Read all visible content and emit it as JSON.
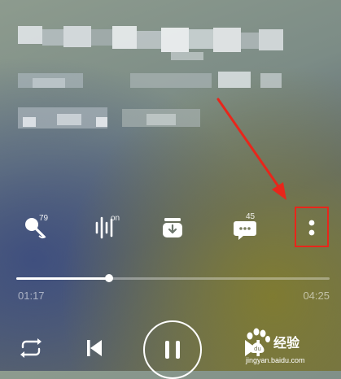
{
  "action_bar": {
    "karaoke_count": "79",
    "sound_effect_state": "on",
    "comments_count": "45"
  },
  "player": {
    "progress_fraction": 0.296,
    "elapsed": "01:17",
    "duration": "04:25"
  },
  "watermark": {
    "brand": "经验",
    "url": "jingyan.baidu.com"
  },
  "colors": {
    "highlight": "#e8261b",
    "icon": "#ffffff"
  }
}
